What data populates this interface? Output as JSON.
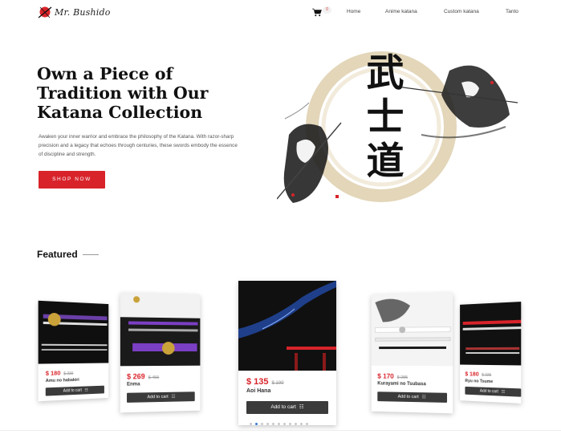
{
  "brand": {
    "name": "Mr. Bushido"
  },
  "nav": {
    "cart_count": "0",
    "links": [
      "Home",
      "Anime katana",
      "Custom katana",
      "Tanto"
    ]
  },
  "hero": {
    "title": "Own a Piece of Tradition with Our Katana Collection",
    "description": "Awaken your inner warrior and embrace the philosophy of the Katana. With razor-sharp precision and a legacy that echoes through centuries, these swords embody the essence of discipline and strength.",
    "cta": "SHOP NOW",
    "art_text": "武士道"
  },
  "featured": {
    "title": "Featured",
    "products": [
      {
        "price": "$ 180",
        "old_price": "$ 239",
        "name": "Amu no habakiri",
        "cta": "Add to cart"
      },
      {
        "price": "$ 269",
        "old_price": "$ 455",
        "name": "Enma",
        "cta": "Add to cart"
      },
      {
        "price": "$ 135",
        "old_price": "$ 199",
        "name": "Aoi Hana",
        "cta": "Add to cart"
      },
      {
        "price": "$ 170",
        "old_price": "$ 285",
        "name": "Kurayami no Tsubasa",
        "cta": "Add to cart"
      },
      {
        "price": "$ 180",
        "old_price": "$ 225",
        "name": "Ryu no Tsume",
        "cta": "Add to cart"
      }
    ],
    "carousel": {
      "total": 11,
      "active": 1
    }
  },
  "colors": {
    "accent": "#d8232a",
    "button_dark": "#3b3b3b",
    "dot_active": "#3a7bd5"
  }
}
